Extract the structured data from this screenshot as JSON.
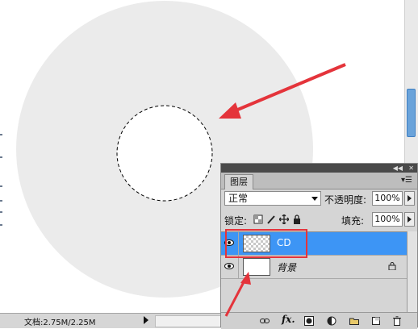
{
  "statusbar": {
    "doc_info": "文档:2.75M/2.25M"
  },
  "layers_panel": {
    "tab_label": "图层",
    "blend_mode": "正常",
    "opacity_label": "不透明度:",
    "opacity_value": "100%",
    "lock_label": "锁定:",
    "fill_label": "填充:",
    "fill_value": "100%",
    "layers": [
      {
        "name": "CD",
        "visible": true,
        "selected": true,
        "thumbnail": "transparent-checker"
      },
      {
        "name": "背景",
        "visible": true,
        "selected": false,
        "locked": true,
        "thumbnail": "white"
      }
    ],
    "footer_icons": [
      "link-layers-icon",
      "fx-icon",
      "layer-mask-icon",
      "adjustment-layer-icon",
      "group-folder-icon",
      "new-layer-icon",
      "trash-icon"
    ]
  },
  "colors": {
    "disc": "#ebebeb",
    "selection_accent": "#3d95f5",
    "annotation_red": "#e4343b",
    "panel_bg": "#d5d5d5"
  }
}
